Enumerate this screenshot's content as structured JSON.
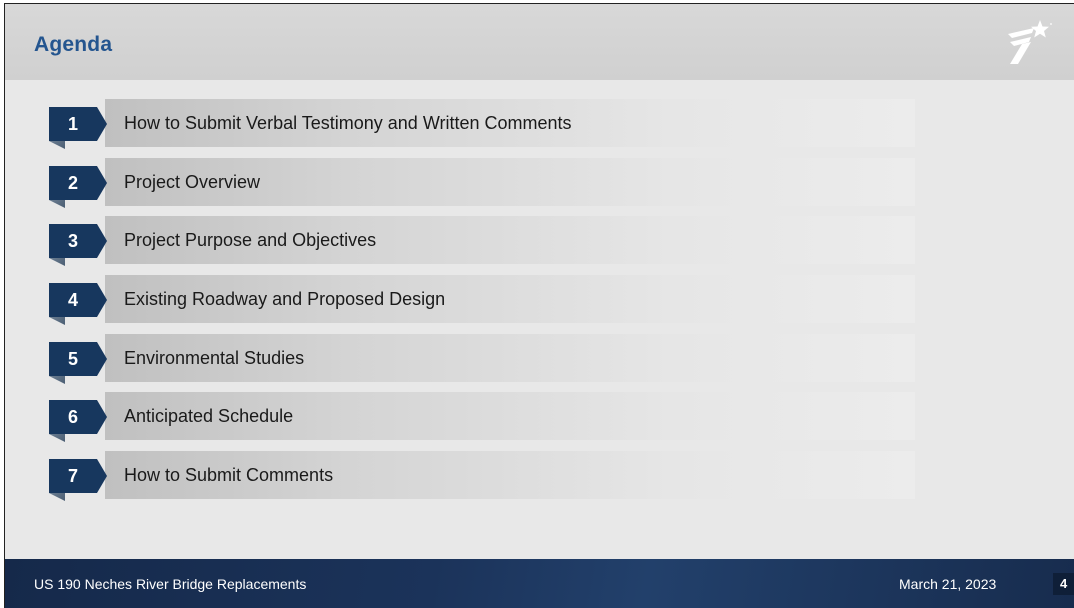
{
  "header": {
    "title": "Agenda"
  },
  "agenda": {
    "items": [
      {
        "number": "1",
        "label": "How to Submit Verbal Testimony and Written Comments"
      },
      {
        "number": "2",
        "label": "Project Overview"
      },
      {
        "number": "3",
        "label": "Project Purpose and Objectives"
      },
      {
        "number": "4",
        "label": "Existing Roadway and Proposed Design"
      },
      {
        "number": "5",
        "label": "Environmental Studies"
      },
      {
        "number": "6",
        "label": "Anticipated Schedule"
      },
      {
        "number": "7",
        "label": "How to Submit Comments"
      }
    ]
  },
  "footer": {
    "project": "US 190 Neches River Bridge Replacements",
    "date": "March 21, 2023",
    "page": "4"
  },
  "colors": {
    "title": "#24558f",
    "number_box": "#17375e",
    "footer": "#1b335a"
  },
  "icons": {
    "logo": "txdot-flying-t-star-logo"
  }
}
